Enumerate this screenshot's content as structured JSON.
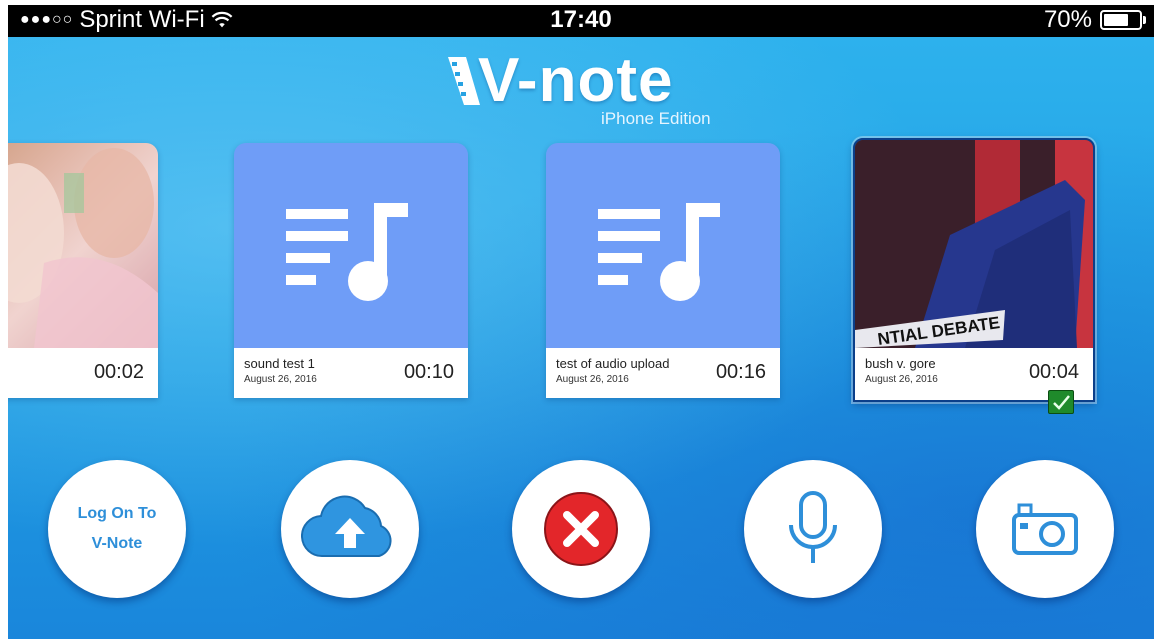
{
  "status_bar": {
    "carrier": "Sprint Wi-Fi",
    "signal": "●●●○○",
    "time": "17:40",
    "battery": "70%",
    "battery_level": 0.7
  },
  "logo": {
    "name": "V-note",
    "edition": "iPhone Edition"
  },
  "recordings": [
    {
      "title": "",
      "date": "",
      "duration": "00:02",
      "type": "video"
    },
    {
      "title": "sound test 1",
      "date": "August 26, 2016",
      "duration": "00:10",
      "type": "audio"
    },
    {
      "title": "test of audio upload",
      "date": "August 26, 2016",
      "duration": "00:16",
      "type": "audio"
    },
    {
      "title": "bush v. gore",
      "date": "August 26, 2016",
      "duration": "00:04",
      "type": "video",
      "selected": true
    }
  ],
  "actions": {
    "login_line1": "Log On To",
    "login_line2": "V-Note",
    "upload": "cloud-upload-icon",
    "delete": "close-icon",
    "record_audio": "microphone-icon",
    "record_video": "camera-icon"
  },
  "colors": {
    "background": "#27a2e2",
    "audio_thumb": "#6f9df7",
    "accent": "#2e8fd9",
    "delete": "#e3262a",
    "check": "#1f8a2b"
  }
}
